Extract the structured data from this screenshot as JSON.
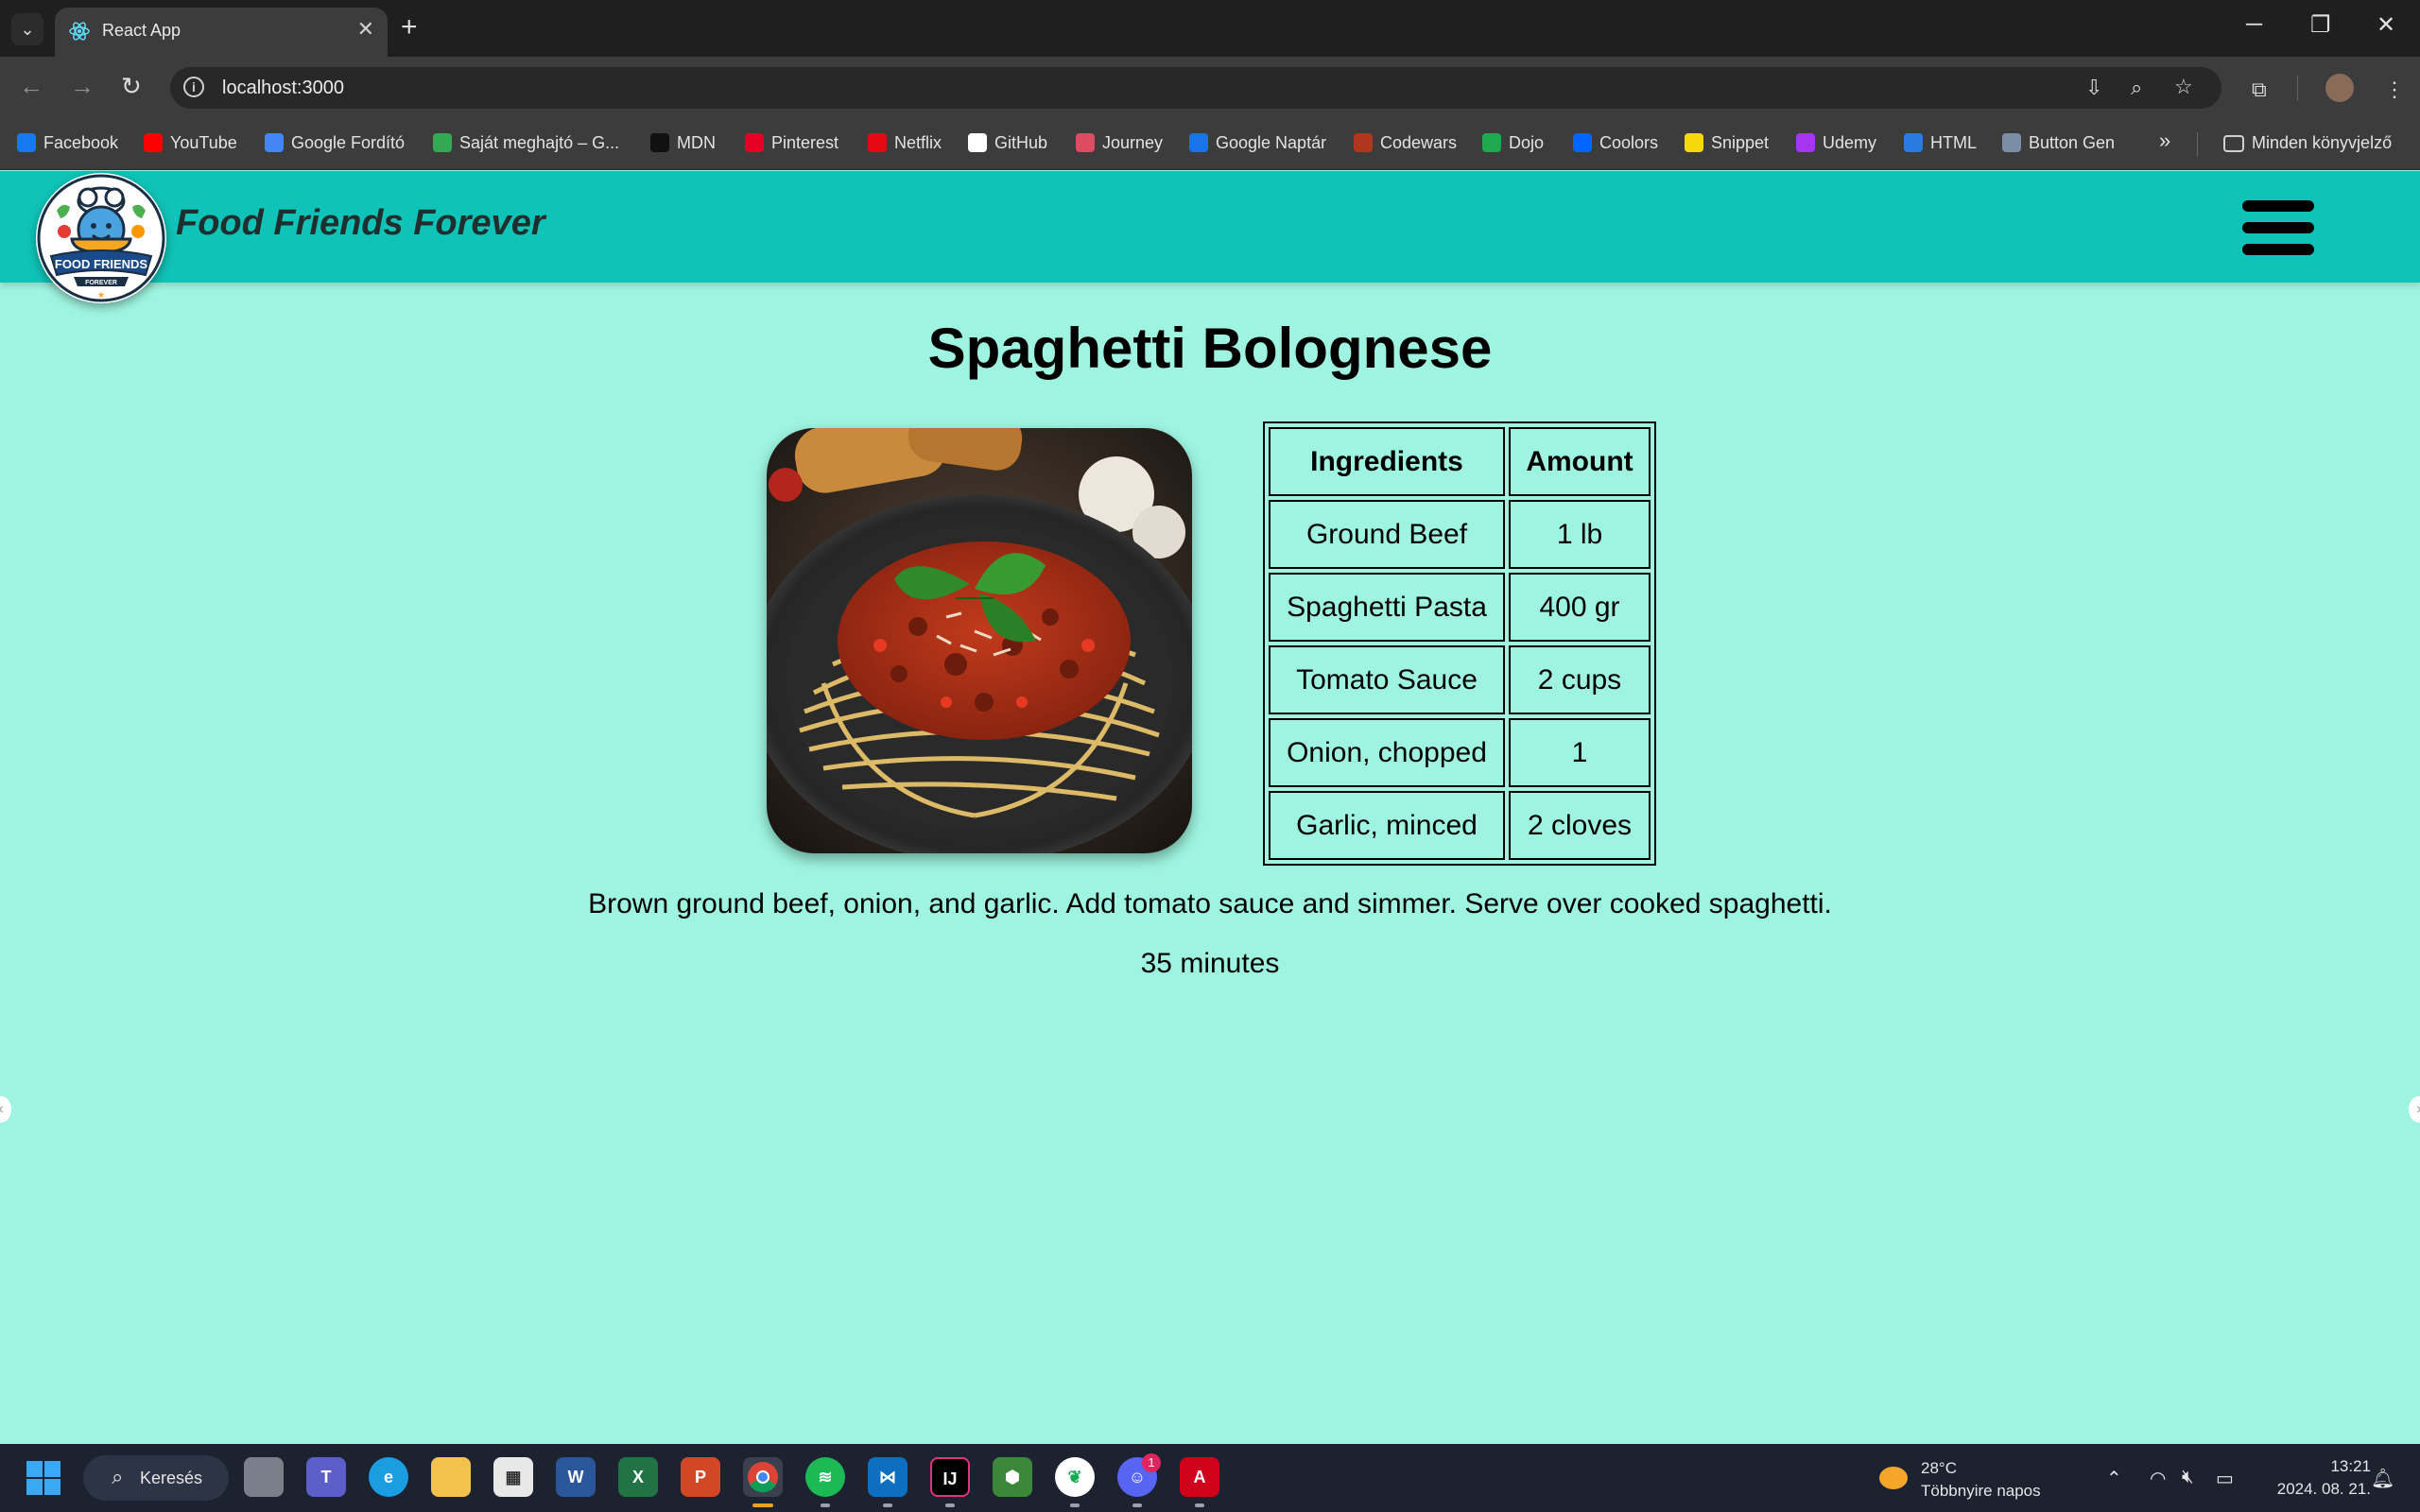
{
  "browser": {
    "tab_title": "React App",
    "url": "localhost:3000",
    "bookmarks": [
      {
        "label": "Facebook",
        "color": "#1877f2"
      },
      {
        "label": "YouTube",
        "color": "#ff0000"
      },
      {
        "label": "Google Fordító",
        "color": "#4285f4"
      },
      {
        "label": "Saját meghajtó – G...",
        "color": "#34a853"
      },
      {
        "label": "MDN",
        "color": "#111111"
      },
      {
        "label": "Pinterest",
        "color": "#e60023"
      },
      {
        "label": "Netflix",
        "color": "#e50914"
      },
      {
        "label": "GitHub",
        "color": "#ffffff"
      },
      {
        "label": "Journey",
        "color": "#e04b64"
      },
      {
        "label": "Google Naptár",
        "color": "#1a73e8"
      },
      {
        "label": "Codewars",
        "color": "#b1361e"
      },
      {
        "label": "Dojo",
        "color": "#1fa84f"
      },
      {
        "label": "Coolors",
        "color": "#0066ff"
      },
      {
        "label": "Snippet",
        "color": "#f5d90a"
      },
      {
        "label": "Udemy",
        "color": "#a435f0"
      },
      {
        "label": "HTML",
        "color": "#2a7ae2"
      },
      {
        "label": "Button Gen",
        "color": "#7a8fa3"
      }
    ],
    "all_bookmarks_label": "Minden könyvjelző"
  },
  "app": {
    "brand": "Food Friends Forever",
    "logo_text_1": "FOOD FRIENDS",
    "logo_text_2": "FOREVER"
  },
  "recipe": {
    "title": "Spaghetti Bolognese",
    "table_headers": [
      "Ingredients",
      "Amount"
    ],
    "ingredients": [
      {
        "name": "Ground Beef",
        "amount": "1 lb"
      },
      {
        "name": "Spaghetti Pasta",
        "amount": "400 gr"
      },
      {
        "name": "Tomato Sauce",
        "amount": "2 cups"
      },
      {
        "name": "Onion, chopped",
        "amount": "1"
      },
      {
        "name": "Garlic, minced",
        "amount": "2 cloves"
      }
    ],
    "instructions": "Brown ground beef, onion, and garlic. Add tomato sauce and simmer. Serve over cooked spaghetti.",
    "duration": "35 minutes"
  },
  "taskbar": {
    "search_label": "Keresés",
    "weather_temp": "28°C",
    "weather_condition": "Többnyire napos",
    "time": "13:21",
    "date": "2024. 08. 21.",
    "discord_badge": "1"
  },
  "colors": {
    "page_bg": "#9ef4e0",
    "header_bg": "#0fc3b8"
  }
}
